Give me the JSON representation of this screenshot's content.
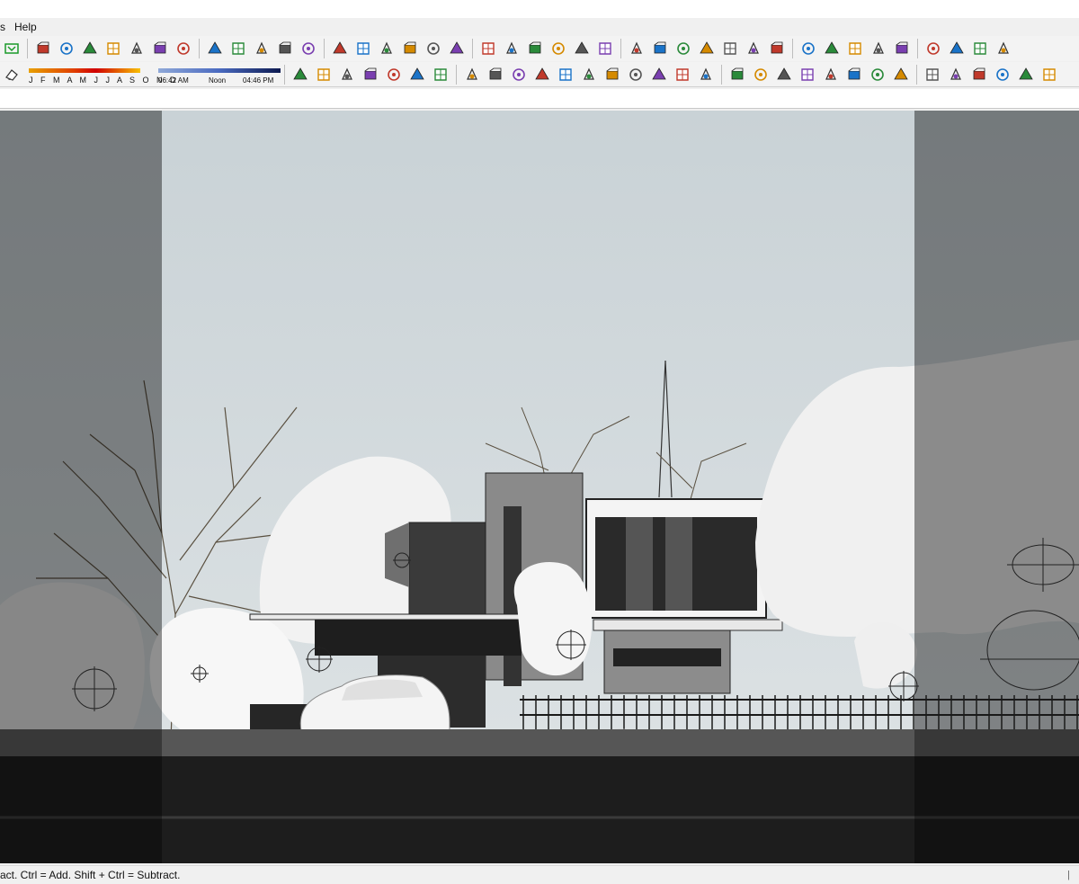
{
  "menu": {
    "items": [
      "s",
      "Help"
    ]
  },
  "shadow": {
    "months_label": "J F M A M J J A S O N D",
    "time_start": "06:42 AM",
    "time_mid": "Noon",
    "time_end": "04:46 PM"
  },
  "status": {
    "hint": "act. Ctrl = Add. Shift + Ctrl = Subtract.",
    "right_mark": "|"
  },
  "colors": {
    "toolbar_bg": "#f3f3f3",
    "sky": "#cfd6d9",
    "accent_blue": "#1a73c8"
  },
  "toolbar_row1_icons": [
    "section-plane-icon",
    "top-view-icon",
    "front-view-icon",
    "right-view-icon",
    "back-view-icon",
    "left-view-icon",
    "bottom-view-icon",
    "iso-view-icon",
    "wireframe-icon",
    "hidden-line-icon",
    "shaded-icon",
    "textured-icon",
    "sandbox-icon",
    "smoove-icon",
    "stamp-icon",
    "drape-icon",
    "add-detail-icon",
    "flip-edge-icon",
    "push-pull-icon",
    "follow-me-icon",
    "offset-icon",
    "intersect-icon",
    "solid-tools-icon",
    "outer-shell-icon",
    "eye-icon",
    "plugin-icon",
    "walk-icon",
    "look-around-icon",
    "position-camera-icon",
    "zoom-extents-icon",
    "gear-icon",
    "sun-icon",
    "cone-icon",
    "line-icon",
    "rectangle-icon",
    "hide-icon",
    "vray-icon",
    "play-icon",
    "stop-icon",
    "component-icon"
  ],
  "toolbar_row2_icons": [
    "eraser-icon",
    "dimension-icon",
    "box-icon",
    "cube-icon",
    "grass-icon",
    "brush-icon",
    "grid-icon",
    "square-icon",
    "table-icon",
    "doors-icon",
    "house-icon",
    "camera-icon",
    "lamp-icon",
    "ring-icon",
    "ruler-icon",
    "pin-icon",
    "star-icon",
    "dome-icon",
    "sphere-icon",
    "group-icon",
    "layers-icon",
    "plane-icon",
    "cube-outline-icon",
    "cube-solid-icon",
    "globe-icon",
    "sphere-wire-icon",
    "hand-icon",
    "palette-icon",
    "material-icon",
    "teapot-icon",
    "render-icon",
    "refresh-icon",
    "cycle-icon"
  ]
}
